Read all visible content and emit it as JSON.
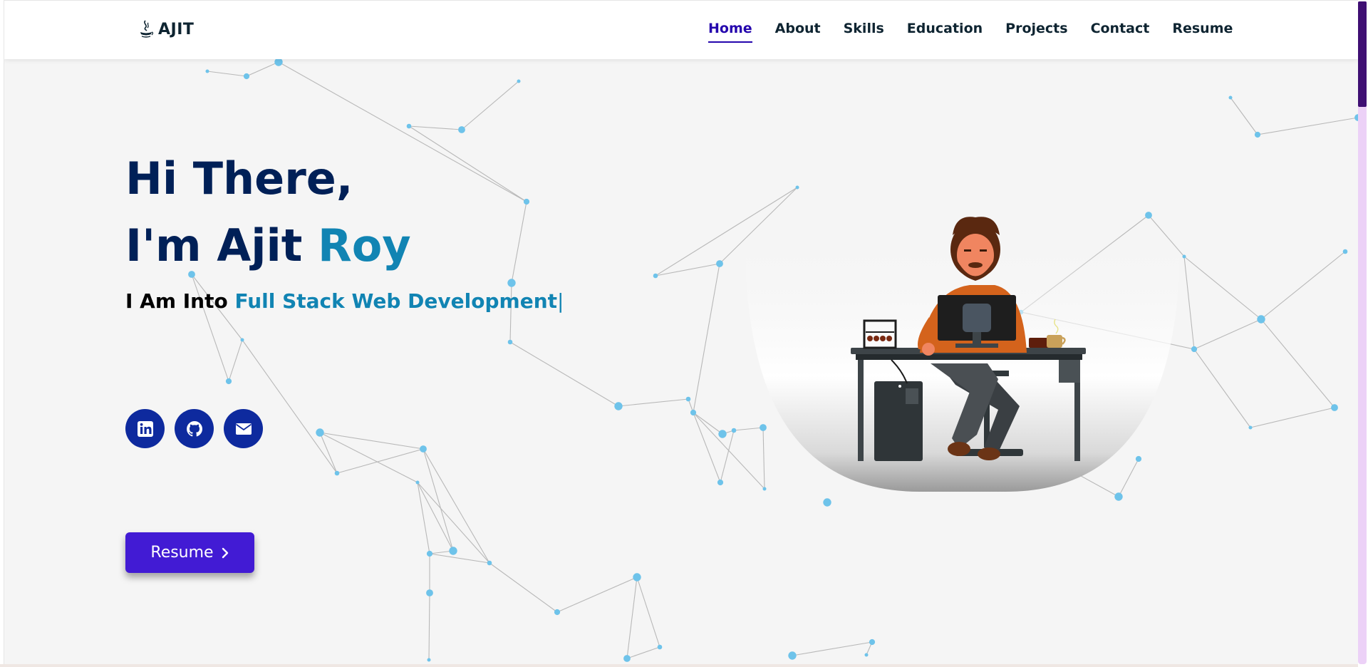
{
  "nav": {
    "logo": "AJIT",
    "logo_icon": "java-icon",
    "links": [
      "Home",
      "About",
      "Skills",
      "Education",
      "Projects",
      "Contact",
      "Resume"
    ],
    "active": "Home"
  },
  "hero": {
    "line1": "Hi There,",
    "line2_prefix": "I'm Ajit ",
    "line2_accent": "Roy",
    "tagline_prefix": "I Am Into ",
    "tagline_typed": "Full Stack Web Development",
    "tagline_cursor": "|",
    "socials": [
      "linkedin-icon",
      "github-icon",
      "envelope-icon"
    ],
    "resume_button": "Resume"
  },
  "colors": {
    "heading": "#002057",
    "accent": "#1184b3",
    "nav_active": "#2506ad",
    "social_bg": "#0e2a9e",
    "button_bg": "#421bd4",
    "scroll_thumb": "#3f0f73",
    "scroll_track": "#ecd1f7"
  }
}
